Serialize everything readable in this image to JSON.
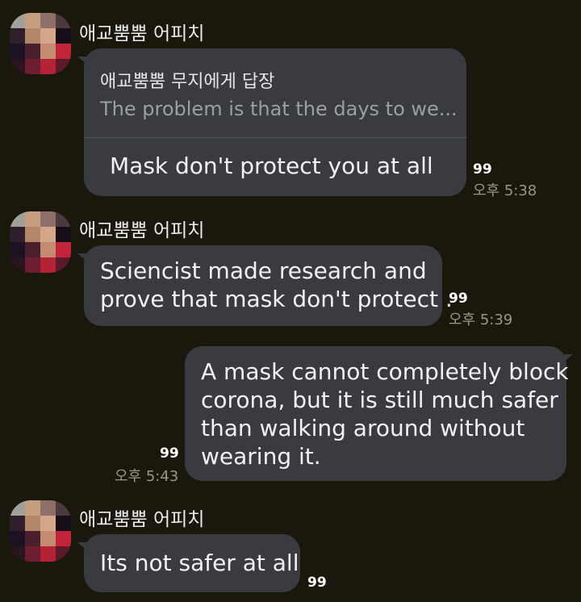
{
  "messages": [
    {
      "sender": "애교뿜뿜 어피치",
      "reply": {
        "header": "애교뿜뿜 무지에게 답장",
        "quote": "The problem is that the days to we..."
      },
      "text": "Mask don't protect you at all",
      "unread": "99",
      "time": "오후 5:38"
    },
    {
      "sender": "애교뿜뿜 어피치",
      "lines": [
        "Sciencist made research and",
        "prove that mask don't protect ."
      ],
      "unread": "99",
      "time": "오후 5:39"
    },
    {
      "outgoing": true,
      "lines": [
        "A mask cannot completely block",
        "corona, but it is still much safer",
        "than walking around without",
        "wearing it."
      ],
      "unread": "99",
      "time": "오후 5:43"
    },
    {
      "sender": "애교뿜뿜 어피치",
      "text": "Its not safer at all",
      "unread": "99"
    }
  ],
  "avatar_colors": [
    "#a3a09a",
    "#c59d7f",
    "#8f6f6a",
    "#4a3a3e",
    "#2f1f2a",
    "#b3876a",
    "#d4a68a",
    "#160d18",
    "#1d1222",
    "#4a1e2c",
    "#c48a72",
    "#c12438",
    "#2a1420",
    "#6e1d30",
    "#b52236",
    "#5a1a28"
  ]
}
